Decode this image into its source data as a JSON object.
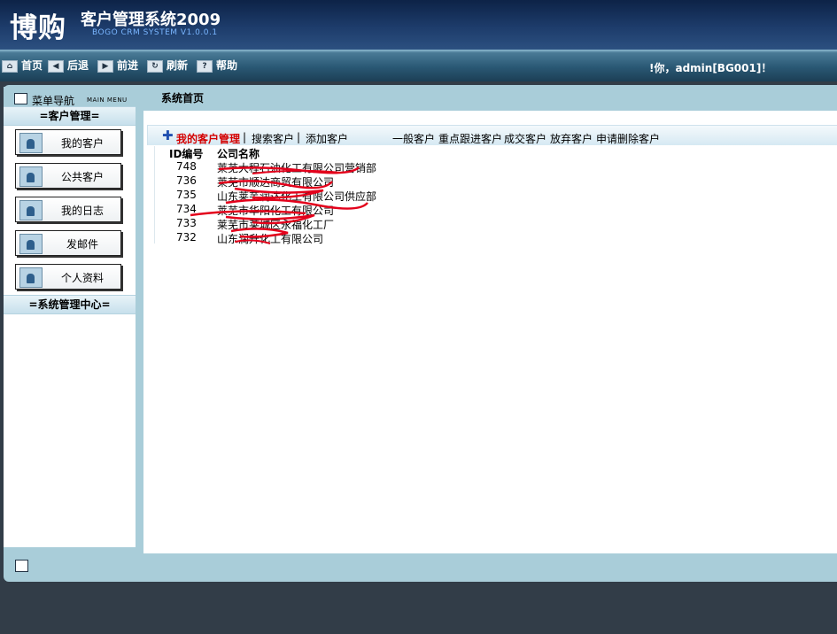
{
  "header": {
    "logo": "博购",
    "title": "客户管理系统2009",
    "subtitle": "BOGO CRM SYSTEM V1.0.0.1"
  },
  "toolbar": {
    "home": "首页",
    "back": "后退",
    "forward": "前进",
    "refresh": "刷新",
    "help": "帮助",
    "welcome": "!你，admin[BG001]！"
  },
  "sidebar": {
    "menu_title": "菜单导航",
    "menu_title_en": "MAIN MENU",
    "group1": "=客户管理=",
    "items": [
      "我的客户",
      "公共客户",
      "我的日志",
      "发邮件",
      "个人资料"
    ],
    "group2": "=系统管理中心="
  },
  "main": {
    "page_title": "系统首页",
    "nav": {
      "my_customers": "我的客户管理",
      "search": "搜索客户",
      "add": "添加客户",
      "general": "一般客户",
      "key_follow": "重点跟进客户",
      "deal": "成交客户",
      "abandon": "放弃客户",
      "delete_request": "申请删除客户",
      "separator": "|"
    },
    "table": {
      "headers": [
        "ID编号",
        "公司名称"
      ],
      "rows": [
        {
          "id": "748",
          "name": "莱芜大程石油化工有限公司营销部"
        },
        {
          "id": "736",
          "name": "莱芜市顺达商贸有限公司"
        },
        {
          "id": "735",
          "name": "山东莱芜润达化工有限公司供应部"
        },
        {
          "id": "734",
          "name": "莱芜市华阳化工有限公司"
        },
        {
          "id": "733",
          "name": "莱芜市莱城区永福化工厂"
        },
        {
          "id": "732",
          "name": "山东润升化工有限公司"
        }
      ]
    }
  },
  "colors": {
    "header_bg": "#0d2347",
    "frame_bg": "#a9cdd9",
    "active_link": "#d40000",
    "scribble": "#e3001b"
  },
  "icons": {
    "home": "home-icon",
    "back": "back-arrow-icon",
    "forward": "forward-arrow-icon",
    "refresh": "refresh-icon",
    "help": "help-icon",
    "menu": "menu-panel-icon",
    "customer": "customer-avatar-icon",
    "add": "plus-icon"
  }
}
